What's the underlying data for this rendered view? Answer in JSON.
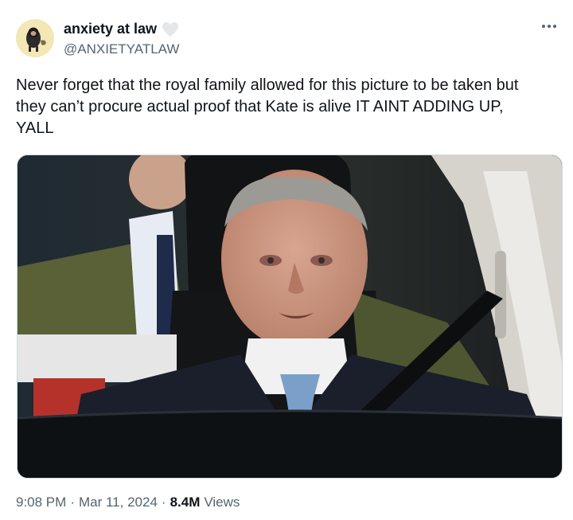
{
  "user": {
    "display_name": "anxiety at law",
    "handle": "@ANXIETYATLAW",
    "badge_icon": "heart-icon"
  },
  "tweet": {
    "text_line1": "Never forget that the royal family allowed for this picture to be taken but",
    "text_line2": "they can’t procure actual proof that Kate is alive IT AINT ADDING UP,",
    "text_line3": "YALL"
  },
  "meta": {
    "time": "9:08 PM",
    "separator": "·",
    "date": "Mar 11, 2024",
    "views_count": "8.4M",
    "views_label": "Views"
  },
  "colors": {
    "secondary_text": "#536471",
    "primary_text": "#0f1419",
    "border": "#cfd9de"
  },
  "icons": {
    "more": "more-icon",
    "avatar": "avatar"
  }
}
